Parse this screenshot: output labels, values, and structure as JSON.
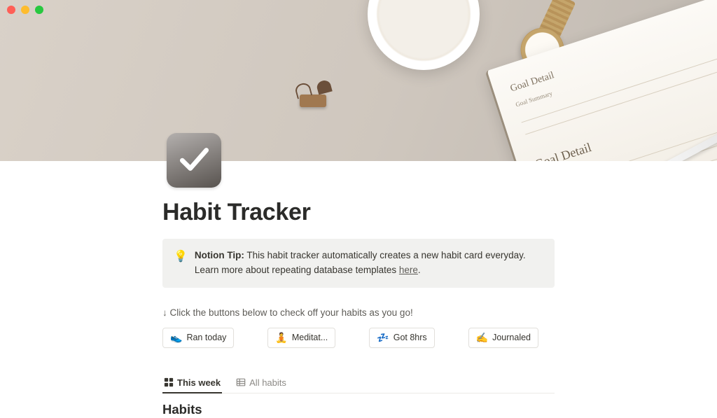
{
  "page": {
    "title": "Habit Tracker"
  },
  "cover": {
    "planner_heading_small": "Goal Detail",
    "planner_heading_large": "Goal Detail",
    "planner_sub": "Goal Summary"
  },
  "callout": {
    "icon": "💡",
    "tip_label": "Notion Tip:",
    "text_before_link": " This habit tracker automatically creates a new habit card everyday. Learn more about repeating database templates ",
    "link_text": "here",
    "text_after_link": "."
  },
  "hint": {
    "text": "↓ Click the buttons below to check off your habits as you go!"
  },
  "buttons": [
    {
      "emoji": "👟",
      "label": "Ran today"
    },
    {
      "emoji": "🧘",
      "label": "Meditat..."
    },
    {
      "emoji": "💤",
      "label": "Got 8hrs"
    },
    {
      "emoji": "✍️",
      "label": "Journaled"
    }
  ],
  "database": {
    "tabs": [
      {
        "label": "This week",
        "view": "gallery",
        "active": true
      },
      {
        "label": "All habits",
        "view": "table",
        "active": false
      }
    ],
    "title": "Habits"
  }
}
